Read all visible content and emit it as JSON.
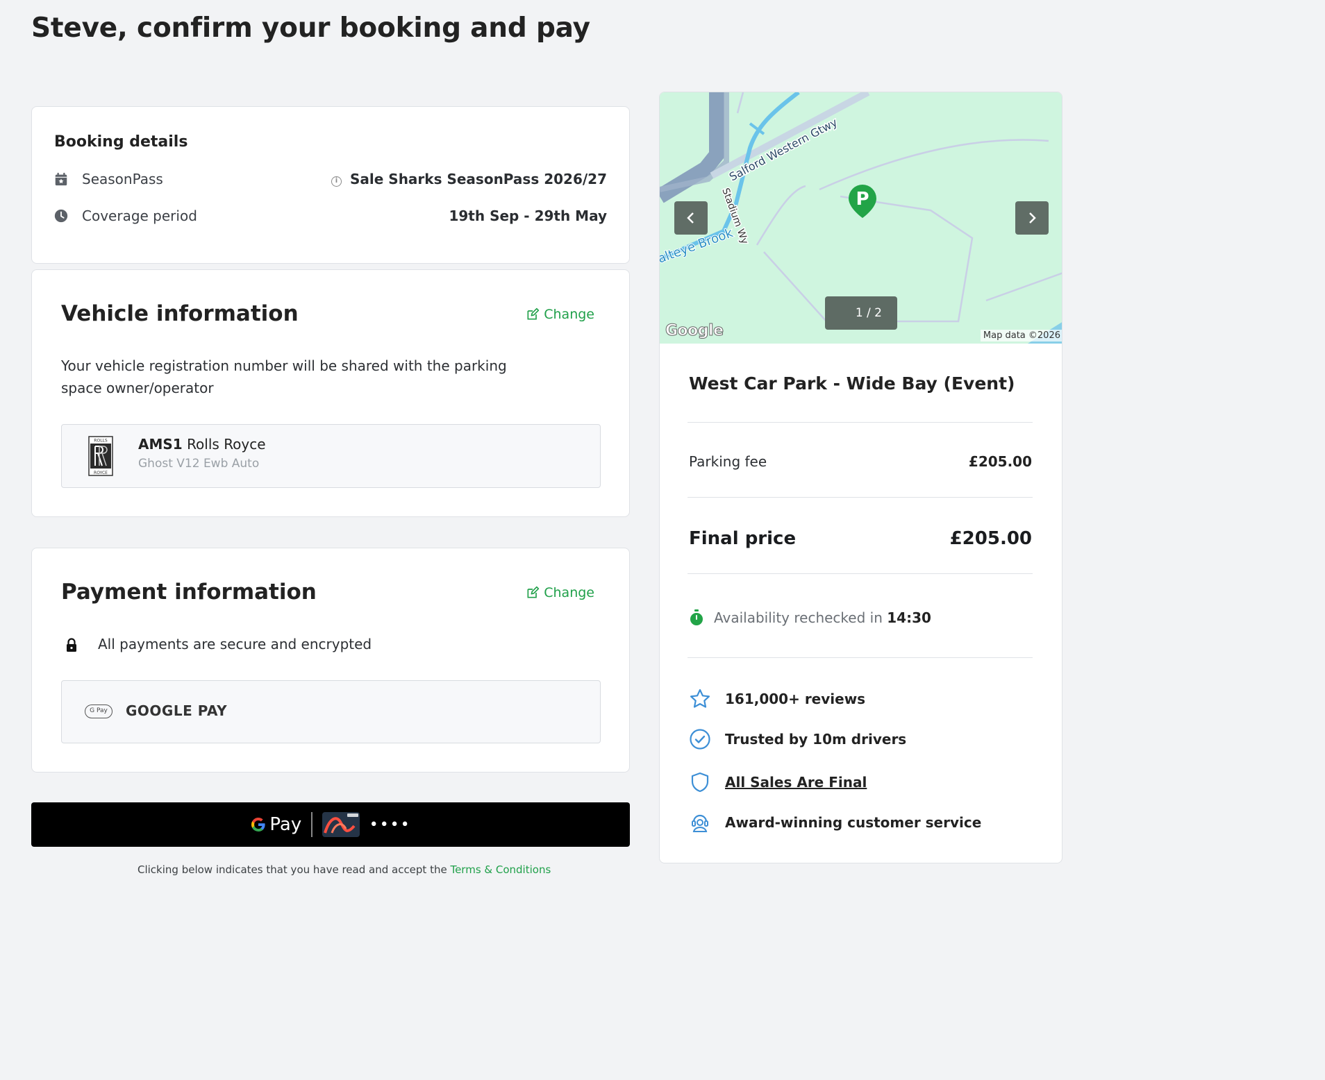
{
  "page": {
    "title": "Steve, confirm your booking and pay"
  },
  "booking": {
    "heading": "Booking details",
    "product_label": "SeasonPass",
    "product_value": "Sale Sharks SeasonPass 2026/27",
    "coverage_label": "Coverage period",
    "coverage_value": "19th Sep - 29th May"
  },
  "vehicle": {
    "heading": "Vehicle information",
    "change_label": "Change",
    "notice": "Your vehicle registration number will be shared with the parking space owner/operator",
    "plate": "AMS1",
    "make": "Rolls Royce",
    "model": "Ghost V12 Ewb Auto"
  },
  "payment": {
    "heading": "Payment information",
    "change_label": "Change",
    "secure_text": "All payments are secure and encrypted",
    "method_badge": "G Pay",
    "method_label": "GOOGLE PAY"
  },
  "pay_button": {
    "brand": "Pay",
    "card_dots": "••••"
  },
  "terms": {
    "text": "Clicking below indicates that you have read and accept the ",
    "link": "Terms & Conditions"
  },
  "map": {
    "counter": "1 / 2",
    "street_1": "Salford Western Gtwy",
    "street_2": "Stadium Wy",
    "water_label": "alteye Brook",
    "google": "Google",
    "attribution": "Map data ©2026",
    "prev_icon": "chevron-left-icon",
    "next_icon": "chevron-right-icon"
  },
  "listing": {
    "name": "West Car Park - Wide Bay (Event)",
    "fee_label": "Parking fee",
    "fee_value": "£205.00",
    "final_label": "Final price",
    "final_value": "£205.00",
    "avail_text": "Availability rechecked in ",
    "avail_time": "14:30"
  },
  "trust": {
    "reviews": "161,000+ reviews",
    "drivers": "Trusted by 10m drivers",
    "sales": "All Sales Are Final",
    "service": "Award-winning customer service"
  },
  "colors": {
    "accent": "#20a04a",
    "trust_icon": "#3d8fd6",
    "map_bg": "#cff5df"
  }
}
